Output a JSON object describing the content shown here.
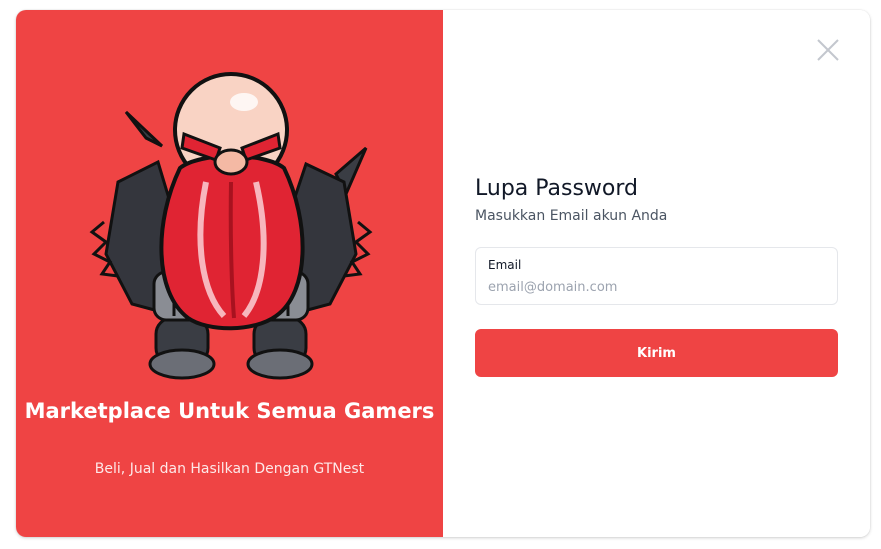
{
  "colors": {
    "brand_red": "#ef4444",
    "text_dark": "#111827",
    "text_muted": "#4b5563",
    "placeholder": "#9ca3af"
  },
  "hero": {
    "mascot_icon": "gamer-dwarf-mascot-illustration",
    "title": "Marketplace Untuk Semua Gamers",
    "subtitle": "Beli, Jual dan Hasilkan Dengan GTNest"
  },
  "form": {
    "close_icon": "close-icon",
    "title": "Lupa Password",
    "subtitle": "Masukkan Email akun Anda",
    "email_label": "Email",
    "email_value": "",
    "email_placeholder": "email@domain.com",
    "submit_label": "Kirim"
  }
}
